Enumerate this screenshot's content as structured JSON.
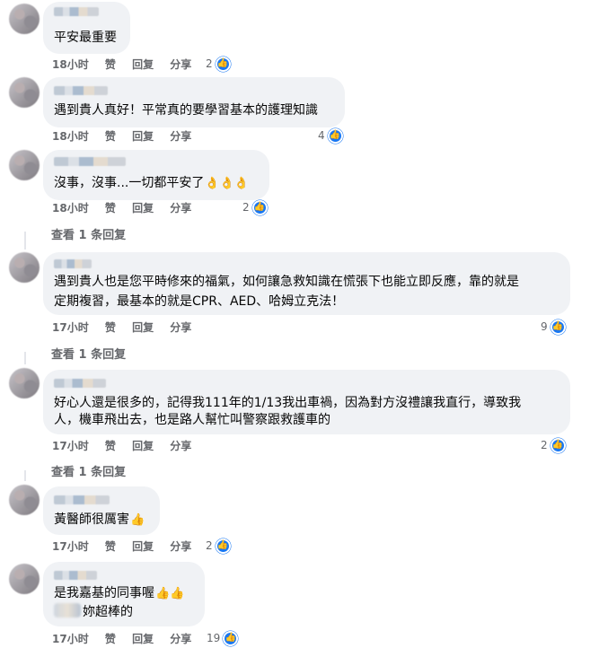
{
  "actions": {
    "like": "赞",
    "reply": "回复",
    "share": "分享"
  },
  "view_replies_label": "查看 1 条回复",
  "comments": [
    {
      "text_lines": [
        "平安最重要"
      ],
      "time": "18小时",
      "reactions": "2"
    },
    {
      "text_lines": [
        "遇到貴人真好！平常真的要學習基本的護理知識"
      ],
      "time": "18小时",
      "reactions": "4"
    },
    {
      "text_lines": [
        "沒事，沒事...一切都平安了"
      ],
      "emoji": "👌👌👌",
      "time": "18小时",
      "reactions": "2"
    },
    {
      "text_lines": [
        "遇到貴人也是您平時修來的福氣，如何讓急救知識在慌張下也能立即反應，靠的就是",
        "定期複習，最基本的就是CPR、AED、哈姆立克法！"
      ],
      "time": "17小时",
      "reactions": "9"
    },
    {
      "text_lines": [
        "好心人還是很多的，記得我111年的1/13我出車禍，因為對方沒禮讓我直行，導致我",
        "人，機車飛出去，也是路人幫忙叫警察跟救護車的"
      ],
      "time": "17小时",
      "reactions": "2"
    },
    {
      "text_lines": [
        "黃醫師很厲害"
      ],
      "emoji": "👍",
      "time": "17小时",
      "reactions": "2"
    },
    {
      "text_lines": [
        "是我嘉基的同事喔",
        "妳超棒的"
      ],
      "emoji": "👍👍",
      "time": "17小时",
      "reactions": "19"
    }
  ],
  "colors": {
    "bubble": "#f0f2f5",
    "action_text": "#65676b",
    "like_blue": "#1877f2"
  },
  "icons": {
    "like_badge": "thumbs-up-icon"
  }
}
